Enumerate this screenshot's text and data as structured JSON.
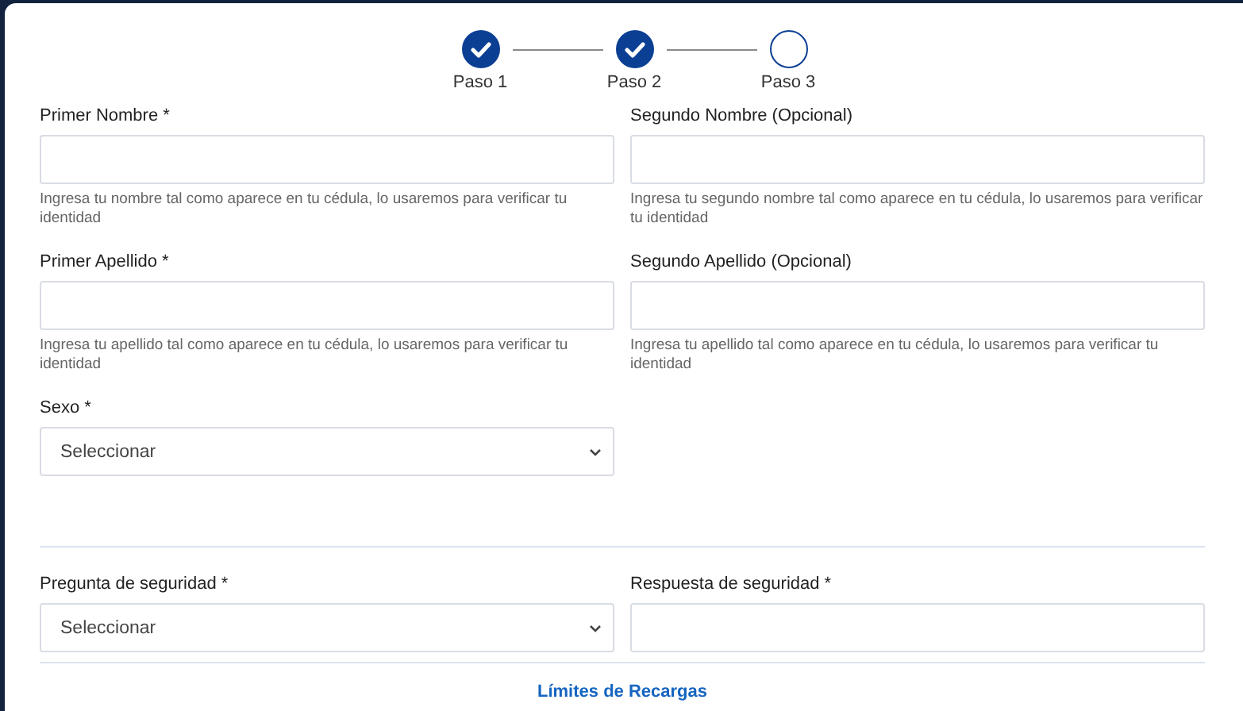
{
  "stepper": [
    {
      "label": "Paso 1",
      "completed": true
    },
    {
      "label": "Paso 2",
      "completed": true
    },
    {
      "label": "Paso 3",
      "completed": false
    }
  ],
  "sections": [
    {
      "fields": [
        {
          "kind": "text",
          "label": "Primer Nombre *",
          "help": "Ingresa tu nombre tal como aparece en tu cédula, lo usaremos para verificar tu identidad"
        },
        {
          "kind": "text",
          "label": "Segundo Nombre (Opcional)",
          "help": "Ingresa tu segundo nombre tal como aparece en tu cédula, lo usaremos para verificar tu identidad"
        },
        {
          "kind": "text",
          "label": "Primer Apellido *",
          "help": "Ingresa tu apellido tal como aparece en tu cédula, lo usaremos para verificar tu identidad"
        },
        {
          "kind": "text",
          "label": "Segundo Apellido (Opcional)",
          "help": "Ingresa tu apellido tal como aparece en tu cédula, lo usaremos para verificar tu identidad"
        },
        {
          "kind": "select",
          "label": "Sexo *",
          "value": "Seleccionar"
        }
      ]
    },
    {
      "fields": [
        {
          "kind": "select",
          "label": "Pregunta de seguridad *",
          "value": "Seleccionar"
        },
        {
          "kind": "text",
          "label": "Respuesta de seguridad *"
        }
      ]
    }
  ],
  "link": "Límites de Recargas"
}
